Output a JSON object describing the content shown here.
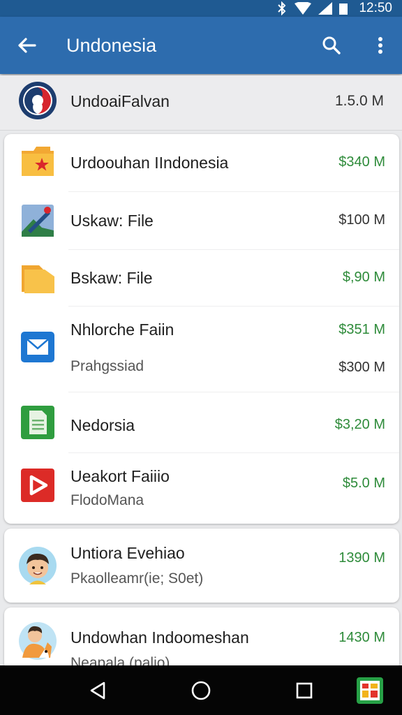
{
  "status": {
    "time": "12:50"
  },
  "app_bar": {
    "title": "Undonesia"
  },
  "top_row": {
    "name": "UndoaiFalvan",
    "size": "1.5.0 M"
  },
  "items": [
    {
      "name": "Urdoouhan IIndonesia",
      "amount": "$340 M",
      "color": "green",
      "icon": "folder-star-icon"
    },
    {
      "name": "Uskaw: File",
      "amount": "$100 M",
      "color": "gray",
      "icon": "image-file-icon"
    },
    {
      "name": "Bskaw: File",
      "amount": "$,90 M",
      "color": "green",
      "icon": "folder-icon"
    },
    {
      "name": "Nhlorche Faiin",
      "amount": "$351 M",
      "sub": "Prahgssiad",
      "sub_amount": "$300 M",
      "color": "green",
      "icon": "mail-icon"
    },
    {
      "name": "Nedorsia",
      "amount": "$3,20 M",
      "color": "green",
      "icon": "document-icon"
    },
    {
      "name": "Ueakort Faiiio",
      "amount": "$5.0 M",
      "sub": "FlodoMana",
      "color": "green",
      "icon": "video-play-icon"
    }
  ],
  "card2": {
    "name": "Untiora Evehiao",
    "sub": "Pkaolleamr(ie; S0et)",
    "amount": "1390 M"
  },
  "card3": {
    "name": "Undowhan Indoomeshan",
    "sub": "Neapala (palio)",
    "amount": "1430 M"
  }
}
